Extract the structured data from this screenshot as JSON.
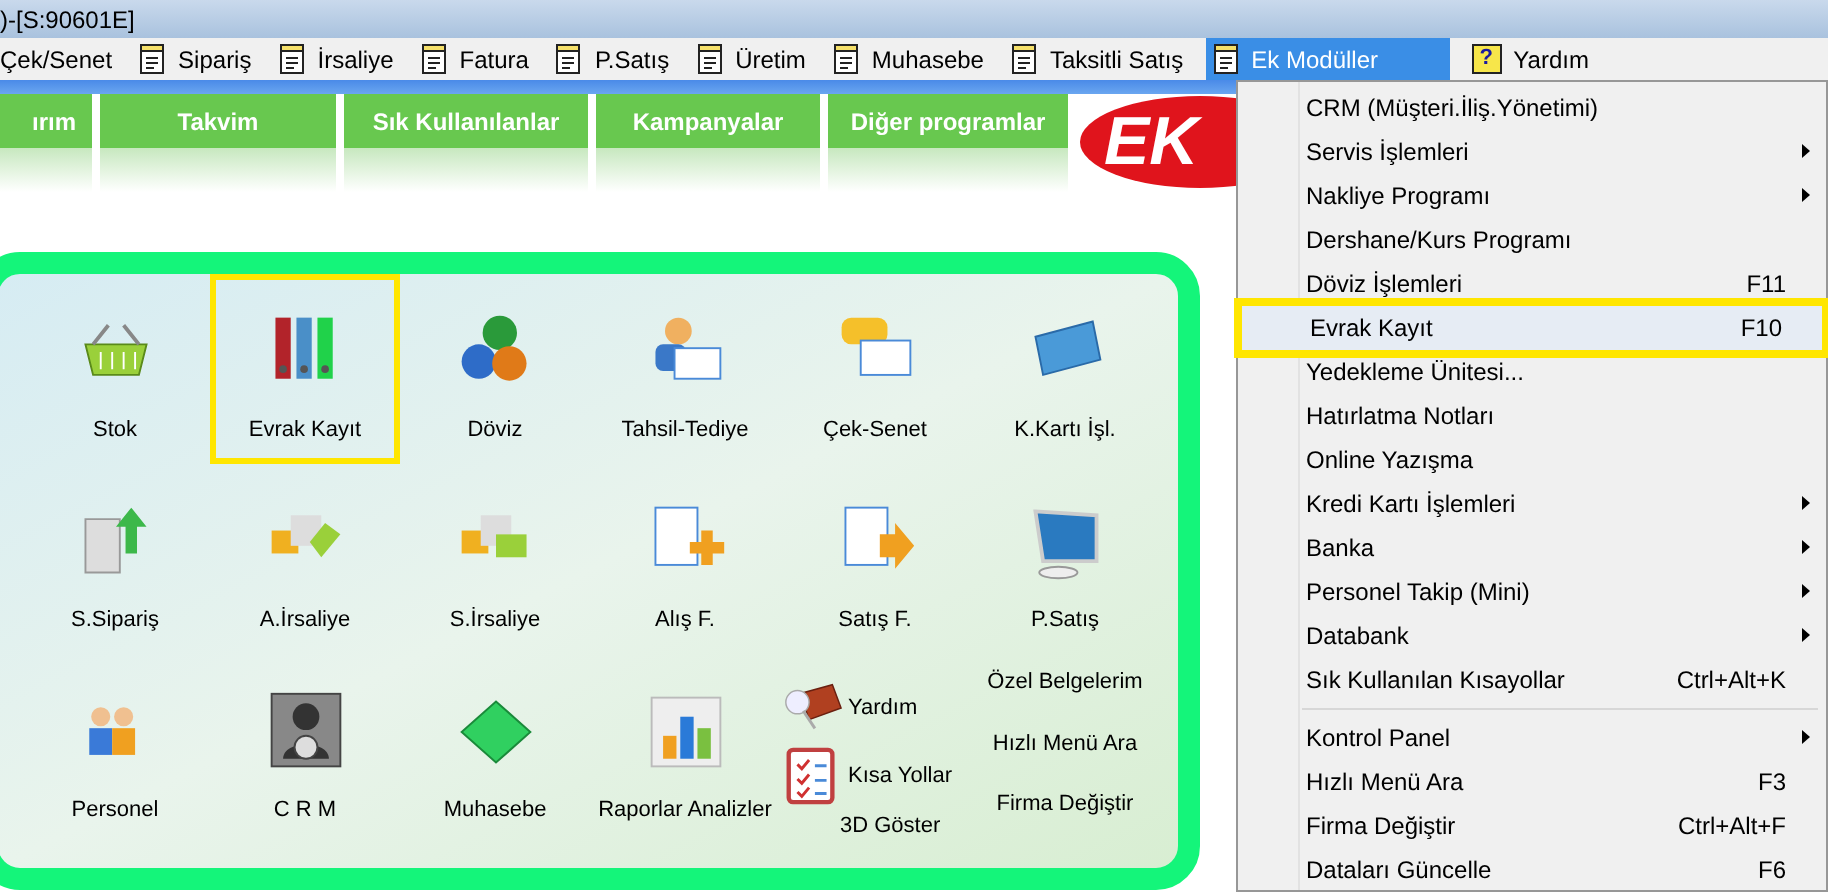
{
  "window": {
    "title": ")-[S:90601E]"
  },
  "menu_bar": [
    {
      "label": "Çek/Senet",
      "selected": false
    },
    {
      "label": "Sipariş",
      "selected": false
    },
    {
      "label": "İrsaliye",
      "selected": false
    },
    {
      "label": "Fatura",
      "selected": false
    },
    {
      "label": "P.Satış",
      "selected": false
    },
    {
      "label": "Üretim",
      "selected": false
    },
    {
      "label": "Muhasebe",
      "selected": false
    },
    {
      "label": "Taksitli Satış",
      "selected": false
    },
    {
      "label": "Ek Modüller",
      "selected": true
    },
    {
      "label": "Yardım",
      "selected": false,
      "kind": "help",
      "icon": "?"
    }
  ],
  "tabs": [
    "ırım",
    "Takvim",
    "Sık Kullanılanlar",
    "Kampanyalar",
    "Diğer programlar"
  ],
  "logo": {
    "text": "EK"
  },
  "grid": {
    "rows": [
      [
        {
          "label": "Stok",
          "highlighted": false
        },
        {
          "label": "Evrak Kayıt",
          "highlighted": true
        },
        {
          "label": "Döviz",
          "highlighted": false
        },
        {
          "label": "Tahsil-Tediye",
          "highlighted": false
        },
        {
          "label": "Çek-Senet",
          "highlighted": false
        },
        {
          "label": "K.Kartı İşl.",
          "highlighted": false
        }
      ],
      [
        {
          "label": "S.Sipariş",
          "highlighted": false
        },
        {
          "label": "A.İrsaliye",
          "highlighted": false
        },
        {
          "label": "S.İrsaliye",
          "highlighted": false
        },
        {
          "label": "Alış F.",
          "highlighted": false
        },
        {
          "label": "Satış F.",
          "highlighted": false
        },
        {
          "label": "P.Satış",
          "highlighted": false
        }
      ],
      [
        {
          "label": "Personel",
          "highlighted": false
        },
        {
          "label": "C R M",
          "highlighted": false
        },
        {
          "label": "Muhasebe",
          "highlighted": false
        },
        {
          "label": "Raporlar Analizler",
          "highlighted": false
        }
      ]
    ],
    "side_items": [
      {
        "label": "Yardım"
      },
      {
        "label": "Kısa Yollar"
      },
      {
        "label": "3D Göster"
      }
    ],
    "links": [
      "Özel Belgelerim",
      "Hızlı Menü Ara",
      "Firma Değiştir"
    ]
  },
  "dropdown": [
    {
      "kind": "item",
      "label": "CRM (Müşteri.İliş.Yönetimi)",
      "submenu": false,
      "highlighted": false
    },
    {
      "kind": "item",
      "label": "Servis İşlemleri",
      "submenu": true,
      "highlighted": false
    },
    {
      "kind": "item",
      "label": "Nakliye Programı",
      "submenu": true,
      "highlighted": false
    },
    {
      "kind": "item",
      "label": "Dershane/Kurs Programı",
      "submenu": false,
      "highlighted": false
    },
    {
      "kind": "item",
      "label": "Döviz İşlemleri",
      "shortcut": "F11",
      "submenu": false,
      "highlighted": false
    },
    {
      "kind": "item",
      "label": "Evrak Kayıt",
      "shortcut": "F10",
      "submenu": false,
      "highlighted": true
    },
    {
      "kind": "item",
      "label": "Yedekleme Ünitesi...",
      "submenu": false,
      "highlighted": false
    },
    {
      "kind": "item",
      "label": "Hatırlatma Notları",
      "submenu": false,
      "highlighted": false
    },
    {
      "kind": "item",
      "label": "Online Yazışma",
      "submenu": false,
      "highlighted": false
    },
    {
      "kind": "item",
      "label": "Kredi Kartı İşlemleri",
      "submenu": true,
      "highlighted": false
    },
    {
      "kind": "item",
      "label": "Banka",
      "submenu": true,
      "highlighted": false
    },
    {
      "kind": "item",
      "label": "Personel Takip (Mini)",
      "submenu": true,
      "highlighted": false
    },
    {
      "kind": "item",
      "label": "Databank",
      "submenu": true,
      "highlighted": false
    },
    {
      "kind": "item",
      "label": "Sık Kullanılan Kısayollar",
      "shortcut": "Ctrl+Alt+K",
      "submenu": false,
      "highlighted": false
    },
    {
      "kind": "separator"
    },
    {
      "kind": "item",
      "label": "Kontrol Panel",
      "submenu": true,
      "highlighted": false
    },
    {
      "kind": "item",
      "label": "Hızlı Menü Ara",
      "shortcut": "F3",
      "submenu": false,
      "highlighted": false
    },
    {
      "kind": "item",
      "label": "Firma Değiştir",
      "shortcut": "Ctrl+Alt+F",
      "submenu": false,
      "highlighted": false
    },
    {
      "kind": "item",
      "label": "Dataları Güncelle",
      "shortcut": "F6",
      "submenu": false,
      "highlighted": false
    }
  ]
}
